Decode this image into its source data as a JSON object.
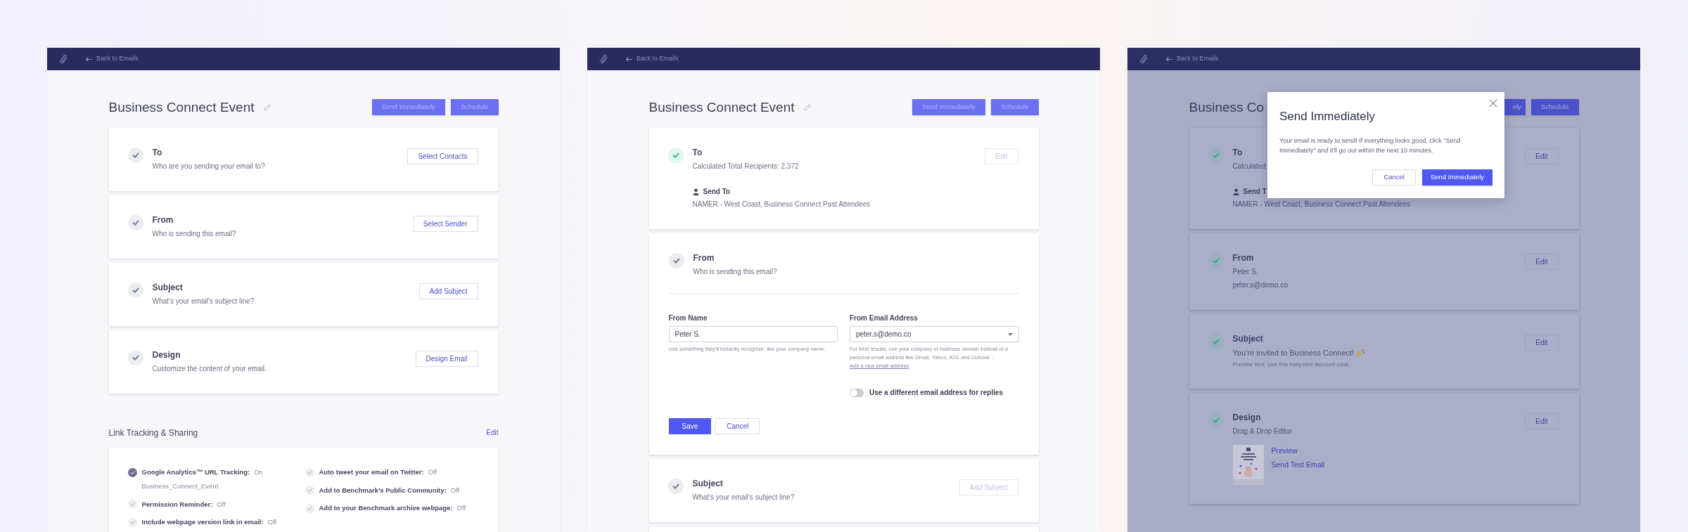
{
  "panels": [
    {
      "back_link": "Back to Emails",
      "title": "Business Connect Event",
      "editable": true,
      "header_buttons": [
        {
          "label": "Send Immediately",
          "disabled": true
        },
        {
          "label": "Schedule",
          "disabled": true
        }
      ],
      "cards": [
        {
          "kind": "step",
          "color": "#7a7c9a",
          "title": "To",
          "lines": [
            {
              "kind": "subtitle",
              "text": "Who are you sending your email to?"
            }
          ],
          "button": {
            "label": "Select Contacts",
            "disabled": false
          }
        },
        {
          "kind": "step",
          "color": "#7a7c9a",
          "title": "From",
          "lines": [
            {
              "kind": "subtitle",
              "text": "Who is sending this email?"
            }
          ],
          "button": {
            "label": "Select Sender",
            "disabled": false
          }
        },
        {
          "kind": "step",
          "color": "#7a7c9a",
          "title": "Subject",
          "lines": [
            {
              "kind": "subtitle",
              "text": "What’s your email’s subject line?"
            }
          ],
          "button": {
            "label": "Add Subject",
            "disabled": false
          }
        },
        {
          "kind": "step",
          "color": "#7a7c9a",
          "title": "Design",
          "lines": [
            {
              "kind": "subtitle",
              "text": "Customize the content of your email."
            }
          ],
          "button": {
            "label": "Design Email",
            "disabled": false
          }
        }
      ],
      "link_tracking": {
        "title": "Link Tracking & Sharing",
        "edit_link": "Edit",
        "columns": [
          [
            {
              "label": "Google Analytics™ URL Tracking:",
              "value": "On",
              "on": true,
              "detail": "Business_Connect_Event"
            },
            {
              "label": "Permission Reminder:",
              "value": "Off",
              "on": false
            },
            {
              "label": "Include webpage version link in email:",
              "value": "Off",
              "on": false
            }
          ],
          [
            {
              "label": "Auto tweet your email on Twitter:",
              "value": "Off",
              "on": false
            },
            {
              "label": "Add to Benchmark’s Public Community:",
              "value": "Off",
              "on": false
            },
            {
              "label": "Add to your Benchmark archive webpage:",
              "value": "Off",
              "on": false
            }
          ]
        ]
      }
    },
    {
      "back_link": "Back to Emails",
      "title": "Business Connect Event",
      "editable": true,
      "header_buttons": [
        {
          "label": "Send Immediately",
          "disabled": true
        },
        {
          "label": "Schedule",
          "disabled": true
        }
      ],
      "cards": [
        {
          "kind": "step",
          "color": "#35c28d",
          "title": "To",
          "lines": [
            {
              "kind": "subtitle",
              "text": "Calculated Total Recipients: 2,372"
            }
          ],
          "send_to": {
            "label": "Send To",
            "value": "NAMER - West Coast, Business Connect Past Attendees"
          },
          "button": {
            "label": "Edit",
            "disabled": true
          }
        },
        {
          "kind": "form",
          "color": "#7a7c9a",
          "title": "From",
          "lines": [
            {
              "kind": "subtitle",
              "text": "Who is sending this email?"
            }
          ],
          "fields": [
            {
              "kind": "text",
              "label": "From Name",
              "value": "Peter S.",
              "help": "Use something they’ll instantly recognize, like your company name."
            },
            {
              "kind": "select",
              "label": "From Email Address",
              "value": "peter.s@demo.co",
              "help": "For best results, use your company or business domain instead of a personal email address like Gmail, Yahoo, AOL and Outlook.  -",
              "help_link": "Add a new email address"
            }
          ],
          "toggle": {
            "label": "Use a different email address for replies",
            "on": false
          },
          "actions": [
            {
              "label": "Save",
              "kind": "primary"
            },
            {
              "label": "Cancel",
              "kind": "secondary"
            }
          ]
        },
        {
          "kind": "step",
          "color": "#7a7c9a",
          "title": "Subject",
          "lines": [
            {
              "kind": "subtitle",
              "text": "What’s your email’s subject line?"
            }
          ],
          "button": {
            "label": "Add Subject",
            "disabled": true
          }
        },
        {
          "kind": "cut_off"
        }
      ]
    },
    {
      "back_link": "Back to Emails",
      "title": "Business Co",
      "header_buttons": [
        {
          "label": "ely",
          "disabled": true
        },
        {
          "label": "Schedule",
          "disabled": true
        }
      ],
      "cards": [
        {
          "kind": "step",
          "color": "#2fae85",
          "title": "To",
          "lines": [
            {
              "kind": "subtitle",
              "text": "Calculated"
            }
          ],
          "send_to": {
            "label": "Send T",
            "value": "NAMER - West Coast, Business Connect Past Attendees"
          },
          "button": {
            "label": "Edit",
            "disabled": false
          }
        },
        {
          "kind": "step",
          "color": "#2fae85",
          "title": "From",
          "lines": [
            {
              "kind": "subtitle",
              "text": "Peter S."
            },
            {
              "kind": "subtitle",
              "text": "peter.s@demo.co"
            }
          ],
          "button": {
            "label": "Edit",
            "disabled": false
          }
        },
        {
          "kind": "step",
          "color": "#2fae85",
          "title": "Subject",
          "lines": [
            {
              "kind": "subject",
              "text": "You’re invited to Business Connect!"
            },
            {
              "kind": "note",
              "text": "Preview Text: Use this early bird discount code."
            }
          ],
          "button": {
            "label": "Edit",
            "disabled": false
          }
        },
        {
          "kind": "step",
          "color": "#2fae85",
          "title": "Design",
          "lines": [
            {
              "kind": "subtitle",
              "text": "Drag & Drop Editor"
            }
          ],
          "preview": {
            "kind": "picture"
          },
          "links": [
            "Preview",
            "Send Test Email"
          ],
          "button": {
            "label": "Edit",
            "disabled": false
          }
        }
      ],
      "modal": {
        "title": "Send Immediately",
        "text": "Your email is ready to send! If everything looks good, click \"Send Immediately\" and it'll go out within the next 10 minutes.",
        "buttons": [
          {
            "label": "Cancel",
            "kind": "secondary"
          },
          {
            "label": "Send Immediately",
            "kind": "primary"
          }
        ]
      }
    }
  ]
}
